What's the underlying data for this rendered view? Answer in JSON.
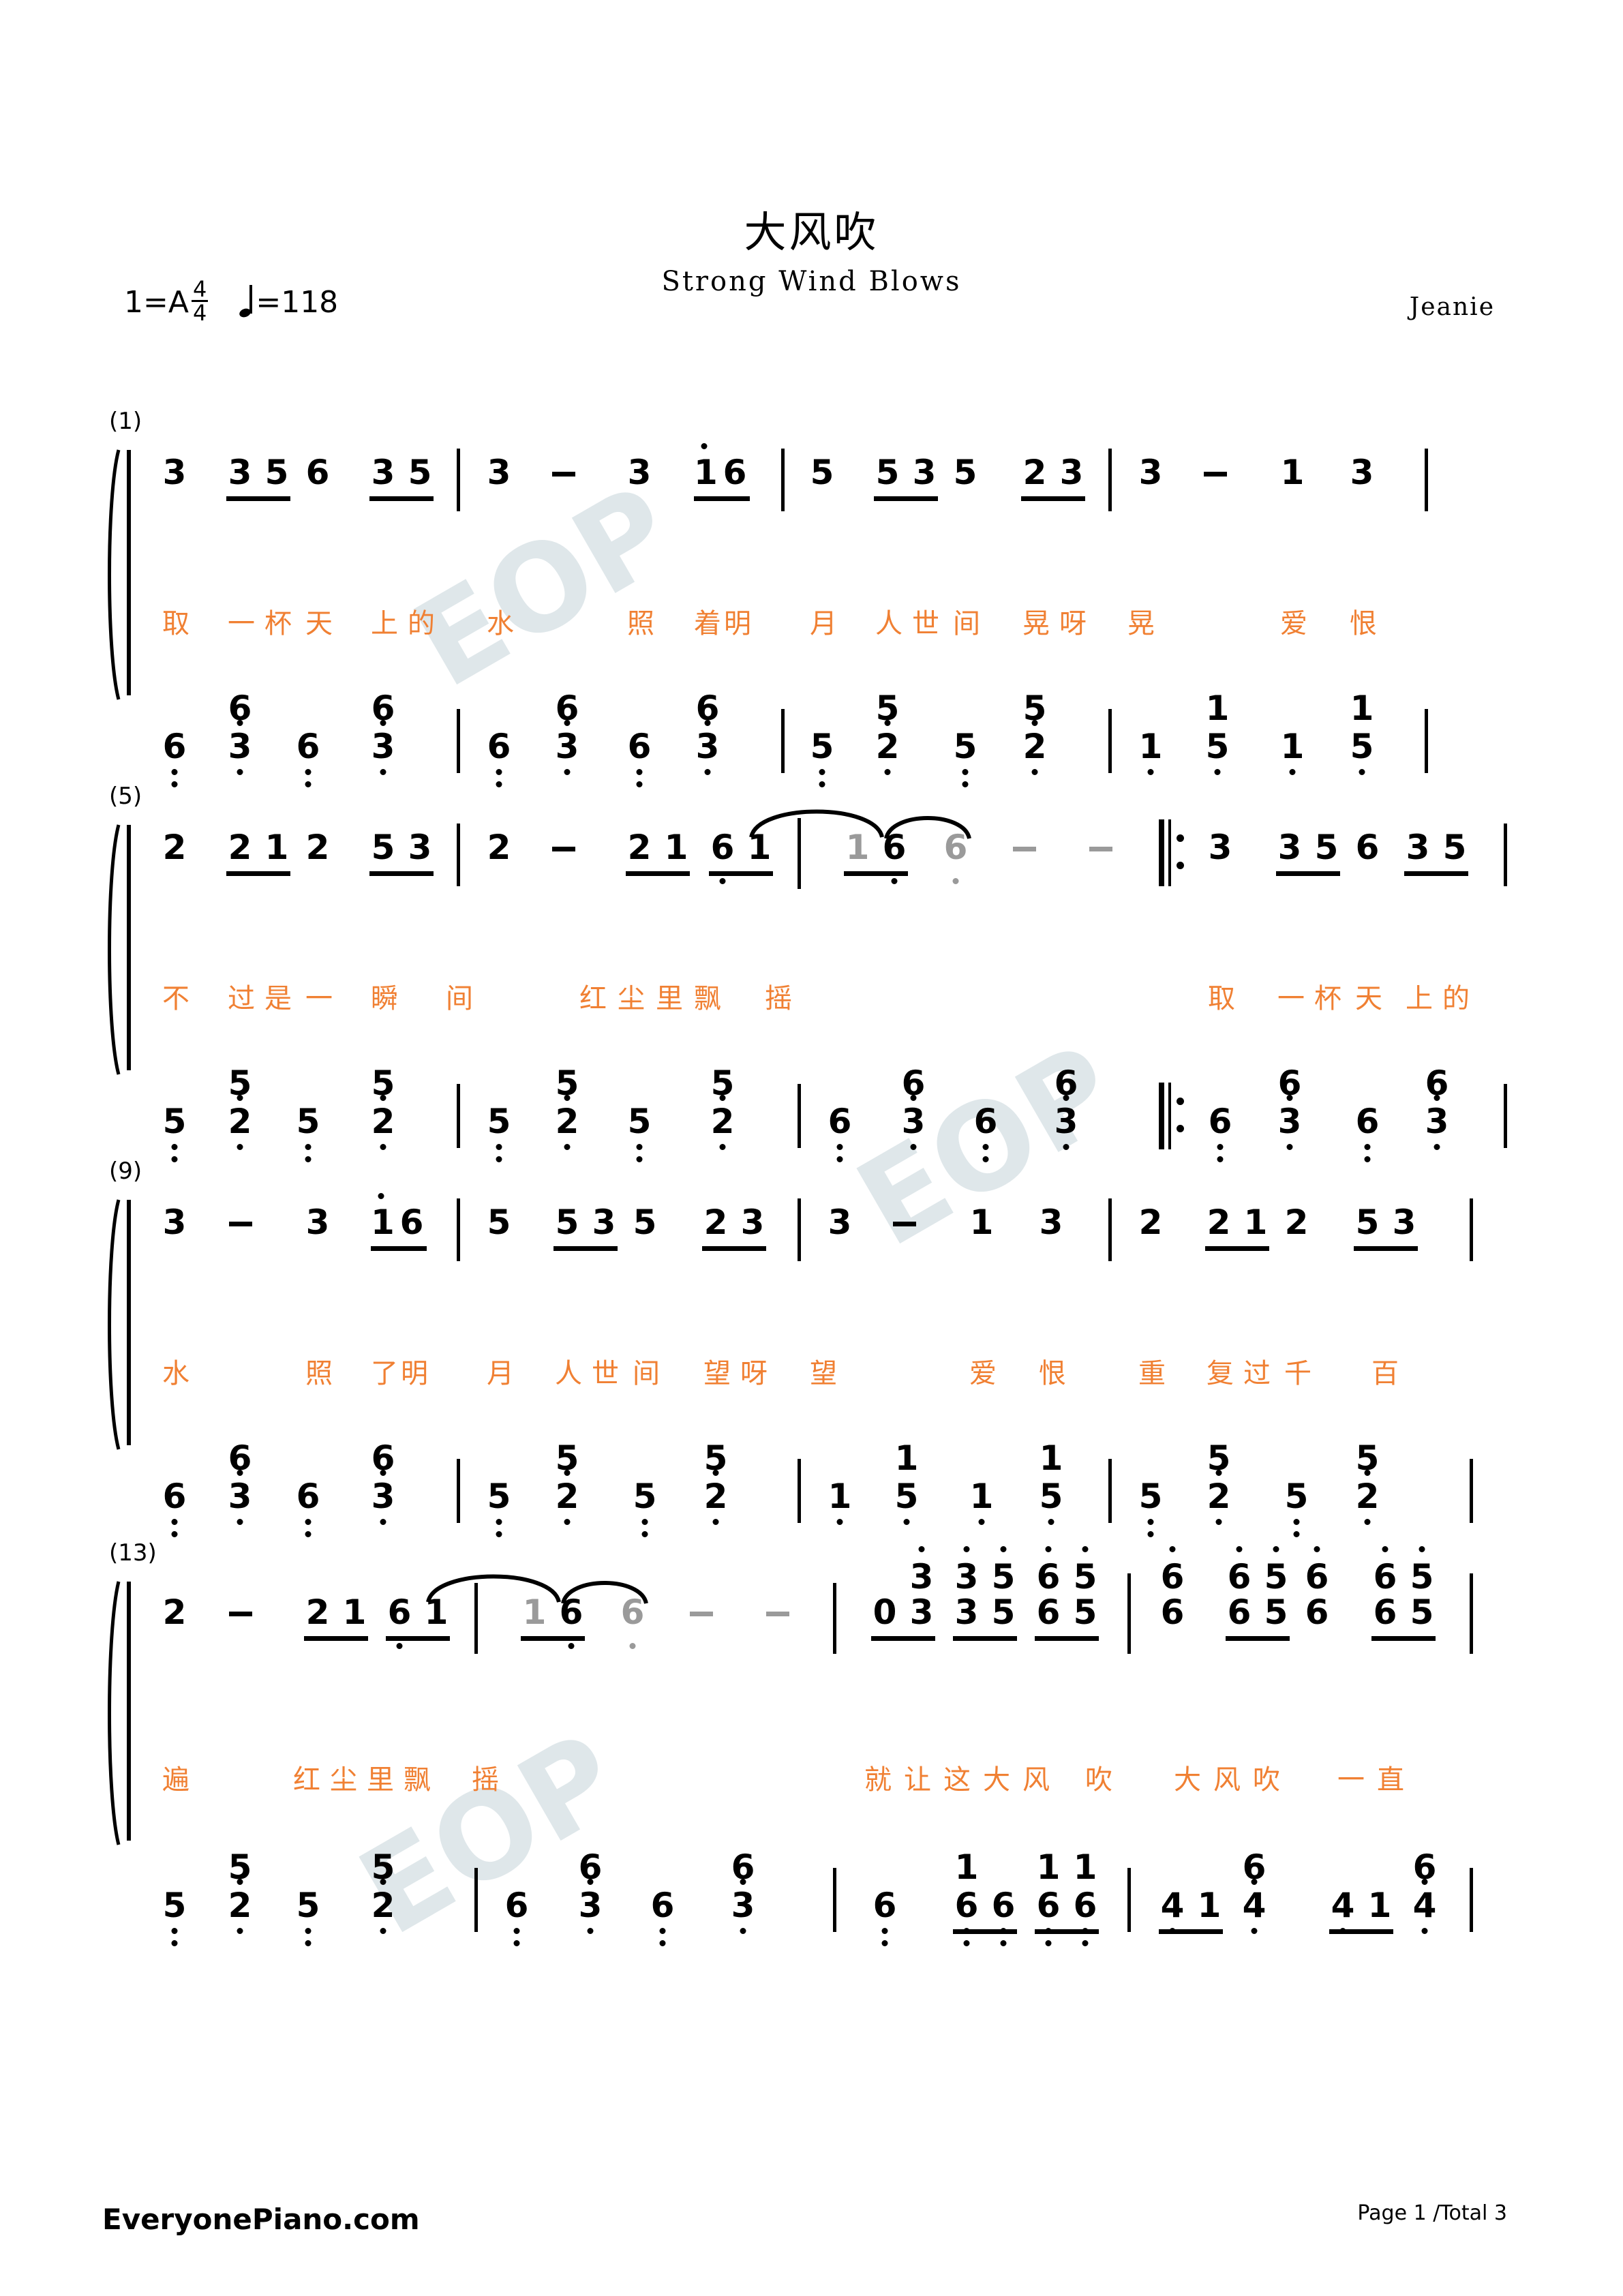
{
  "header": {
    "title": "大风吹",
    "subtitle": "Strong Wind Blows",
    "key_label": "1=A",
    "time_num": "4",
    "time_den": "4",
    "tempo_label": "=118",
    "composer": "Jeanie"
  },
  "footer": {
    "site": "EveryonePiano.com",
    "page_info": "Page 1 /Total 3"
  },
  "watermark": {
    "text": "EOP",
    "color": "#dfe7ea"
  },
  "colors": {
    "lyric": "#f08033",
    "note": "#000000",
    "ghost_note": "#9a9a9a"
  },
  "systems": [
    {
      "measure_label": "(1)",
      "melody": "3  35 6  35 | 3 - 3 i6 | 5  535  23 | 3 - 1 3 |",
      "lyrics": "取 一杯天 上的 水 照 着明 月 人世间 晃呀 晃 爱 恨",
      "bass": "6. 6/3 6. 6/3 | 6. 6/3 6. 6/3 | 5. 5/2 5. 5/2 | 1. 1/5 1. 1/5 |"
    },
    {
      "measure_label": "(5)",
      "melody": "2  21 2  53 | 2 - 21 61 | (1)6 (6) - - :|| 3  35 6  35 |",
      "lyrics": "不 过是一 瞬 间 红尘里飘 摇 取 一杯天 上的",
      "bass": "5. 5/2 5. 5/2 | 5. 5/2 5. 5/2 | 6. 6/3 6. 6/3 :|| 6. 6/3 6. 6/3 |"
    },
    {
      "measure_label": "(9)",
      "melody": "3 - 3 i6 | 5  535  23 | 3 - 1 3 | 2  21 2  53 |",
      "lyrics": "水 照 了明 月 人世间 望呀 望 爱 恨 重 复过千 百",
      "bass": "6. 6/3 6. 6/3 | 5. 5/2 5. 5/2 | 1. 1/5 1. 1/5 | 5. 5/2 5. 5/2 |"
    },
    {
      "measure_label": "(13)",
      "melody": "2 - 21 61 | (1)6 (6) - - | 0 03 35 65 | 6 656 65 |",
      "lyrics": "遍 红尘里飘 摇 就 让这大风 吹 大风吹 一直",
      "bass": "5. 5/2 5. 5/2 | 6. 6/3 6. 6/3 | 6. 6 6 6 6 (1 1 1) | 4.1.4 4.1.4 |"
    }
  ],
  "lyric_lines": {
    "sys1": [
      "取",
      "一",
      "杯",
      "天",
      "上",
      "的",
      "水",
      "照",
      "着",
      "明",
      "月",
      "人",
      "世",
      "间",
      "晃",
      "呀",
      "晃",
      "爱",
      "恨"
    ],
    "sys2": [
      "不",
      "过",
      "是",
      "一",
      "瞬",
      "间",
      "红",
      "尘",
      "里",
      "飘",
      "摇",
      "取",
      "一",
      "杯",
      "天",
      "上",
      "的"
    ],
    "sys3": [
      "水",
      "照",
      "了",
      "明",
      "月",
      "人",
      "世",
      "间",
      "望",
      "呀",
      "望",
      "爱",
      "恨",
      "重",
      "复",
      "过",
      "千",
      "百"
    ],
    "sys4": [
      "遍",
      "红",
      "尘",
      "里",
      "飘",
      "摇",
      "就",
      "让",
      "这",
      "大",
      "风",
      "吹",
      "大",
      "风",
      "吹",
      "一",
      "直"
    ]
  }
}
